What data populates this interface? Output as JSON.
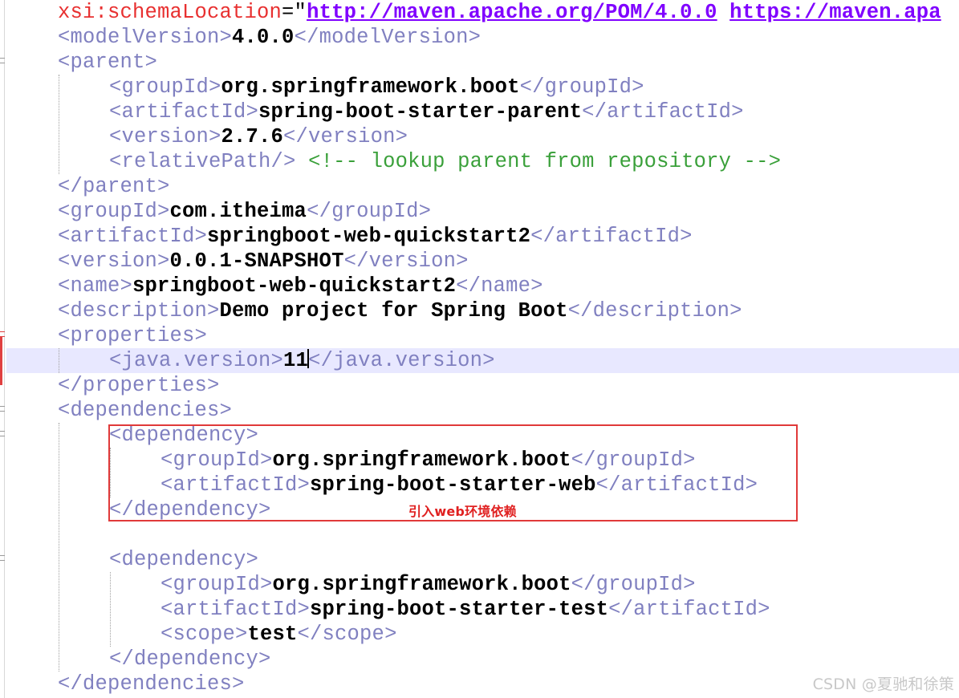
{
  "lines": [
    {
      "parts": [
        "xsi:schemaLocation",
        "=\"",
        "http://maven.apache.org/POM/4.0.0",
        "https://maven.apa"
      ]
    },
    {
      "parts": [
        "<modelVersion>",
        "4.0.0",
        "</modelVersion>"
      ]
    },
    {
      "parts": [
        "<parent>"
      ]
    },
    {
      "parts": [
        "<groupId>",
        "org.springframework.boot",
        "</groupId>"
      ]
    },
    {
      "parts": [
        "<artifactId>",
        "spring-boot-starter-parent",
        "</artifactId>"
      ]
    },
    {
      "parts": [
        "<version>",
        "2.7.6",
        "</version>"
      ]
    },
    {
      "parts": [
        "<relativePath/>",
        "<!-- lookup parent from repository -->"
      ]
    },
    {
      "parts": [
        "</parent>"
      ]
    },
    {
      "parts": [
        "<groupId>",
        "com.itheima",
        "</groupId>"
      ]
    },
    {
      "parts": [
        "<artifactId>",
        "springboot-web-quickstart2",
        "</artifactId>"
      ]
    },
    {
      "parts": [
        "<version>",
        "0.0.1-SNAPSHOT",
        "</version>"
      ]
    },
    {
      "parts": [
        "<name>",
        "springboot-web-quickstart2",
        "</name>"
      ]
    },
    {
      "parts": [
        "<description>",
        "Demo project for Spring Boot",
        "</description>"
      ]
    },
    {
      "parts": [
        "<properties>"
      ]
    },
    {
      "parts": [
        "<java.version>",
        "11",
        "</java.version>"
      ]
    },
    {
      "parts": [
        "</properties>"
      ]
    },
    {
      "parts": [
        "<dependencies>"
      ]
    },
    {
      "parts": [
        "<dependency>"
      ]
    },
    {
      "parts": [
        "<groupId>",
        "org.springframework.boot",
        "</groupId>"
      ]
    },
    {
      "parts": [
        "<artifactId>",
        "spring-boot-starter-web",
        "</artifactId>"
      ]
    },
    {
      "parts": [
        "</dependency>"
      ]
    },
    {
      "parts": [
        "<dependency>"
      ]
    },
    {
      "parts": [
        "<groupId>",
        "org.springframework.boot",
        "</groupId>"
      ]
    },
    {
      "parts": [
        "<artifactId>",
        "spring-boot-starter-test",
        "</artifactId>"
      ]
    },
    {
      "parts": [
        "<scope>",
        "test",
        "</scope>"
      ]
    },
    {
      "parts": [
        "</dependency>"
      ]
    },
    {
      "parts": [
        "</dependencies>"
      ]
    }
  ],
  "annotation": "引入web环境依赖",
  "watermark": "CSDN @夏驰和徐策",
  "colors": {
    "tag": "#8080c0",
    "text": "#000000",
    "attribute": "#e83030",
    "string": "#8000ff",
    "comment": "#3aa03a",
    "current_line": "#e8e8ff",
    "highlight_box": "#e03a3a"
  }
}
